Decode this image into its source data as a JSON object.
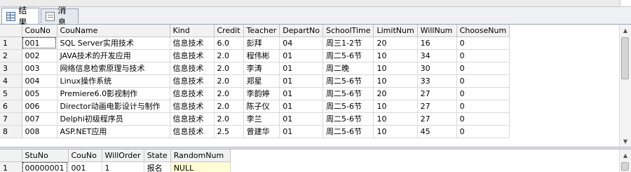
{
  "tabs": [
    {
      "label": "结果",
      "icon": "results-grid-icon",
      "active": true
    },
    {
      "label": "消息",
      "icon": "messages-icon",
      "active": false
    }
  ],
  "courses": {
    "columns": [
      "",
      "CouNo",
      "CouName",
      "Kind",
      "Credit",
      "Teacher",
      "DepartNo",
      "SchoolTime",
      "LimitNum",
      "WillNum",
      "ChooseNum"
    ],
    "rows": [
      [
        "1",
        "001",
        "SQL Server实用技术",
        "信息技术",
        "6.0",
        "彭拜",
        "04",
        "周三1-2节",
        "20",
        "16",
        "0"
      ],
      [
        "2",
        "002",
        "JAVA技术的开发应用",
        "信息技术",
        "2.0",
        "程伟彬",
        "01",
        "周二5-6节",
        "10",
        "34",
        "0"
      ],
      [
        "3",
        "003",
        "网络信息检索原理与技术",
        "信息技术",
        "2.0",
        "李涛",
        "01",
        "周二晚",
        "10",
        "30",
        "0"
      ],
      [
        "4",
        "004",
        "Linux操作系统",
        "信息技术",
        "2.0",
        "郑星",
        "01",
        "周二5-6节",
        "10",
        "33",
        "0"
      ],
      [
        "5",
        "005",
        "Premiere6.0影视制作",
        "信息技术",
        "2.0",
        "李韵婷",
        "01",
        "周二5-6节",
        "20",
        "27",
        "0"
      ],
      [
        "6",
        "006",
        "Director动画电影设计与制作",
        "信息技术",
        "2.0",
        "陈子仪",
        "01",
        "周二5-6节",
        "10",
        "27",
        "0"
      ],
      [
        "7",
        "007",
        "Delphi初级程序员",
        "信息技术",
        "2.0",
        "李兰",
        "01",
        "周二5-6节",
        "10",
        "27",
        "0"
      ],
      [
        "8",
        "008",
        "ASP.NET应用",
        "信息技术",
        "2.5",
        "曾建华",
        "01",
        "周二5-6节",
        "10",
        "45",
        "0"
      ]
    ]
  },
  "stucou": {
    "columns": [
      "",
      "StuNo",
      "CouNo",
      "WillOrder",
      "State",
      "RandomNum"
    ],
    "rows": [
      [
        "1",
        "00000001",
        "001",
        "1",
        "报名",
        "NULL"
      ]
    ]
  }
}
